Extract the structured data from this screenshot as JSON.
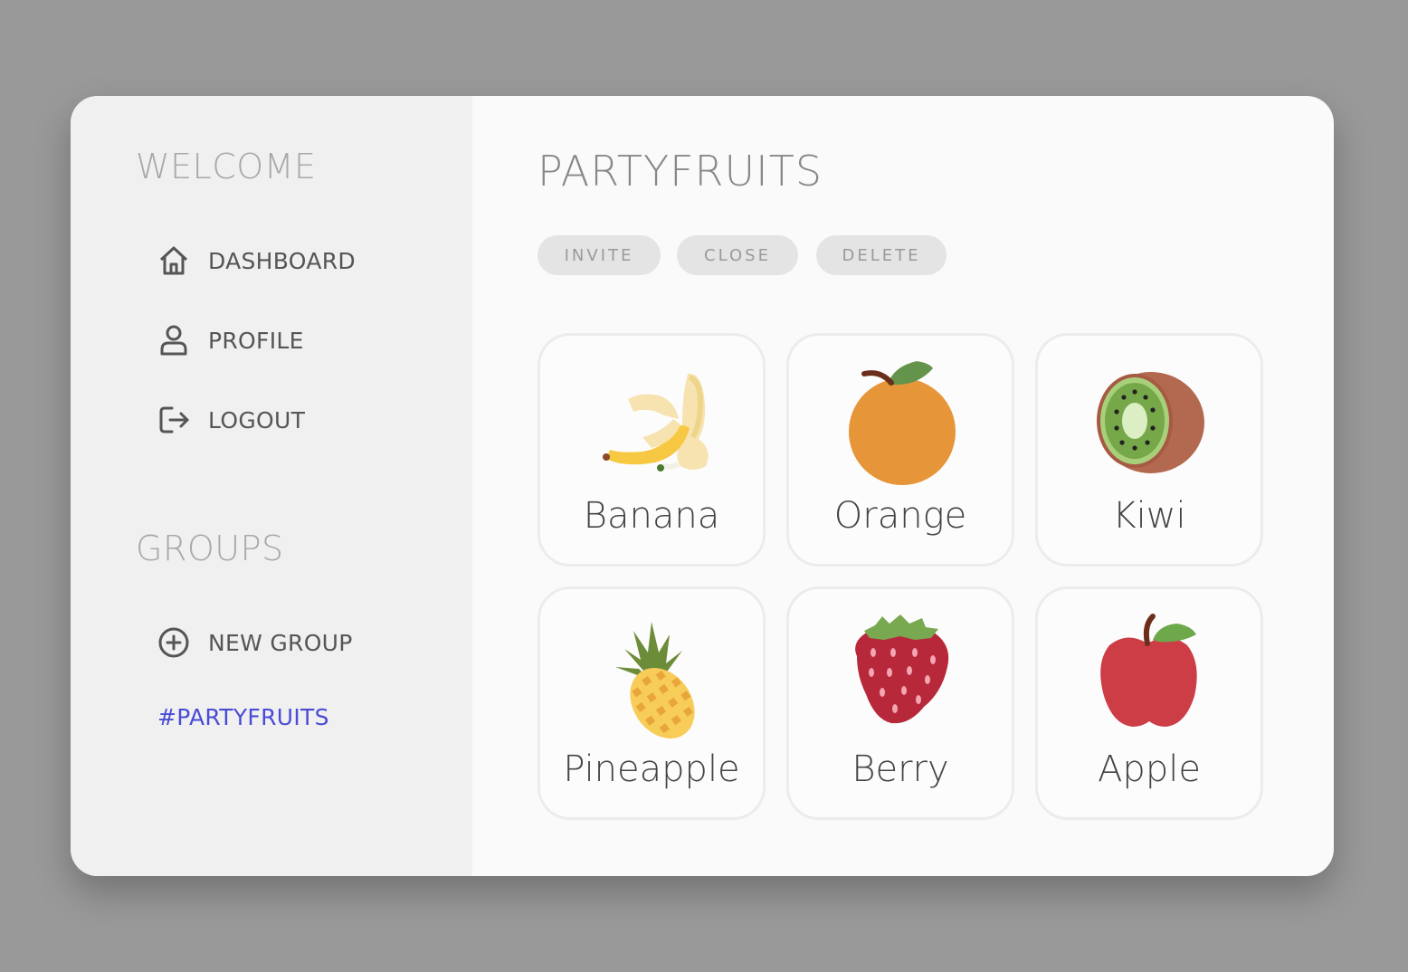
{
  "sidebar": {
    "welcome_heading": "WELCOME",
    "nav": [
      {
        "label": "DASHBOARD",
        "icon": "home-icon"
      },
      {
        "label": "PROFILE",
        "icon": "user-icon"
      },
      {
        "label": "LOGOUT",
        "icon": "logout-icon"
      }
    ],
    "groups_heading": "GROUPS",
    "new_group": {
      "label": "NEW GROUP",
      "icon": "plus-circle-icon"
    },
    "groups": [
      {
        "label": "#PARTYFRUITS",
        "color": "#4a4cd6"
      }
    ]
  },
  "main": {
    "title": "PARTYFRUITS",
    "actions": {
      "invite": "INVITE",
      "close": "CLOSE",
      "delete": "DELETE"
    },
    "fruits": [
      {
        "label": "Banana",
        "icon": "banana-icon"
      },
      {
        "label": "Orange",
        "icon": "orange-icon"
      },
      {
        "label": "Kiwi",
        "icon": "kiwi-icon"
      },
      {
        "label": "Pineapple",
        "icon": "pineapple-icon"
      },
      {
        "label": "Berry",
        "icon": "strawberry-icon"
      },
      {
        "label": "Apple",
        "icon": "apple-icon"
      }
    ]
  },
  "colors": {
    "background": "#999999",
    "sidebar": "#f0f0f0",
    "main": "#fafafa",
    "accent": "#4a4cd6",
    "button": "#e4e4e4"
  }
}
